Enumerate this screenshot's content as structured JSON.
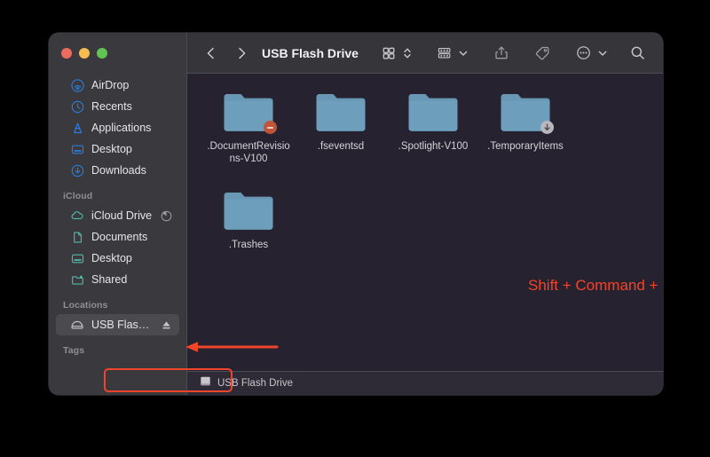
{
  "window": {
    "title": "USB Flash Drive",
    "traffic_lights": [
      {
        "name": "close",
        "color": "#ed6a5e"
      },
      {
        "name": "minimize",
        "color": "#f5bd4f"
      },
      {
        "name": "maximize",
        "color": "#61c454"
      }
    ]
  },
  "toolbar": {
    "back_label": "Back",
    "forward_label": "Forward",
    "title": "USB Flash Drive",
    "view_icon_label": "Icon View",
    "view_stepper_label": "Change view",
    "group_label": "Group items",
    "group_chevron_label": "Group menu",
    "share_label": "Share",
    "tag_label": "Tags",
    "more_label": "More",
    "more_chevron_label": "More menu",
    "search_label": "Search"
  },
  "sidebar": {
    "groups": [
      {
        "label": "",
        "items": [
          {
            "label": "AirDrop",
            "icon": "airdrop-icon",
            "color": "#2a7ce0",
            "selected": false,
            "trailing": ""
          },
          {
            "label": "Recents",
            "icon": "clock-icon",
            "color": "#2a7ce0",
            "selected": false,
            "trailing": ""
          },
          {
            "label": "Applications",
            "icon": "applications-icon",
            "color": "#2a7ce0",
            "selected": false,
            "trailing": ""
          },
          {
            "label": "Desktop",
            "icon": "desktop-icon",
            "color": "#2a7ce0",
            "selected": false,
            "trailing": ""
          },
          {
            "label": "Downloads",
            "icon": "downloads-icon",
            "color": "#2a7ce0",
            "selected": false,
            "trailing": ""
          }
        ]
      },
      {
        "label": "iCloud",
        "items": [
          {
            "label": "iCloud Drive",
            "icon": "cloud-icon",
            "color": "#4fb9ac",
            "selected": false,
            "trailing": "progress-icon"
          },
          {
            "label": "Documents",
            "icon": "document-icon",
            "color": "#4fb9ac",
            "selected": false,
            "trailing": ""
          },
          {
            "label": "Desktop",
            "icon": "desktop-icon",
            "color": "#4fb9ac",
            "selected": false,
            "trailing": ""
          },
          {
            "label": "Shared",
            "icon": "shared-folder-icon",
            "color": "#4fb9ac",
            "selected": false,
            "trailing": ""
          }
        ]
      },
      {
        "label": "Locations",
        "items": [
          {
            "label": "USB Flash...",
            "icon": "external-drive-icon",
            "color": "#b9b7bd",
            "selected": true,
            "trailing": "eject-icon"
          }
        ]
      },
      {
        "label": "Tags",
        "items": []
      }
    ]
  },
  "content": {
    "files": [
      {
        "name": ".DocumentRevisions-V100",
        "kind": "folder",
        "badge": "deny"
      },
      {
        "name": ".fseventsd",
        "kind": "folder",
        "badge": ""
      },
      {
        "name": ".Spotlight-V100",
        "kind": "folder",
        "badge": ""
      },
      {
        "name": ".TemporaryItems",
        "kind": "folder",
        "badge": "download"
      },
      {
        "name": ".Trashes",
        "kind": "folder",
        "badge": ""
      }
    ],
    "hint_text": "Shift + Command + >",
    "hint_color": "#f0452a"
  },
  "statusbar": {
    "label": "USB Flash Drive",
    "icon": "drive-icon"
  },
  "annotations": {
    "arrow_color": "#f0452a",
    "highlight_color": "#f0452a",
    "arrow_target": "USB Flash... sidebar item"
  }
}
